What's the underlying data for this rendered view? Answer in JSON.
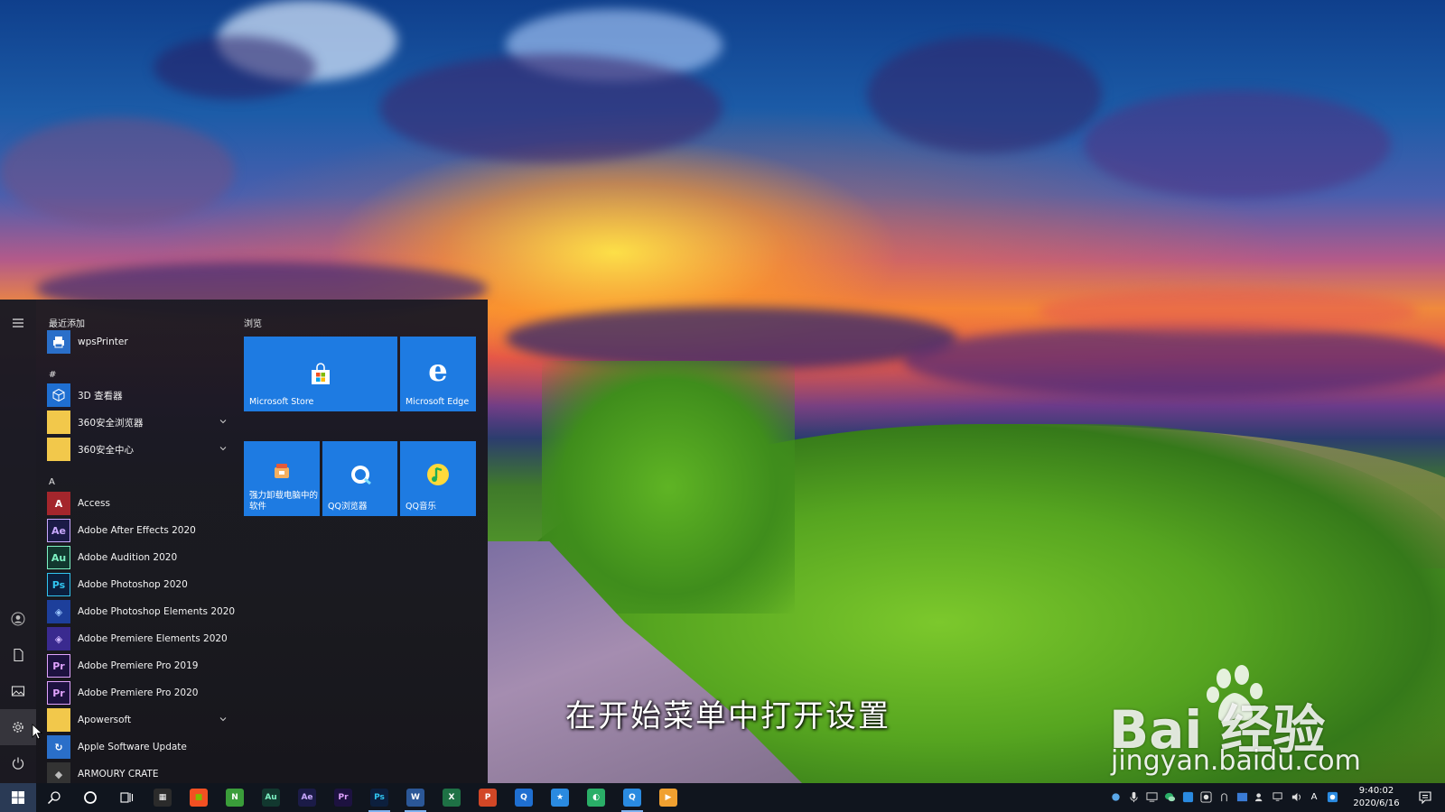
{
  "desktop": {
    "caption": "在开始菜单中打开设置",
    "watermark_logo": "Bai  经验",
    "watermark_url": "jingyan.baidu.com"
  },
  "start_menu": {
    "recent_header": "最近添加",
    "recent_items": [
      {
        "label": "wpsPrinter",
        "icon": "printer-icon",
        "color": "#2a6fc9"
      }
    ],
    "section_hash": "#",
    "hash_items": [
      {
        "label": "3D 查看器",
        "icon": "cube-icon",
        "color": "#1f6fd1"
      },
      {
        "label": "360安全浏览器",
        "icon": "folder-icon",
        "color": "#f2c84b",
        "expandable": true
      },
      {
        "label": "360安全中心",
        "icon": "folder-icon",
        "color": "#f2c84b",
        "expandable": true
      }
    ],
    "section_a": "A",
    "a_items": [
      {
        "label": "Access",
        "icon_text": "A",
        "color": "#a4262c"
      },
      {
        "label": "Adobe After Effects 2020",
        "icon_text": "Ae",
        "color": "#1b1b47"
      },
      {
        "label": "Adobe Audition 2020",
        "icon_text": "Au",
        "color": "#12382f"
      },
      {
        "label": "Adobe Photoshop 2020",
        "icon_text": "Ps",
        "color": "#0c1f3d"
      },
      {
        "label": "Adobe Photoshop Elements 2020",
        "icon_text": "◈",
        "color": "#1d3f9b"
      },
      {
        "label": "Adobe Premiere Elements 2020",
        "icon_text": "◈",
        "color": "#3a2a8f"
      },
      {
        "label": "Adobe Premiere Pro 2019",
        "icon_text": "Pr",
        "color": "#1d1240"
      },
      {
        "label": "Adobe Premiere Pro 2020",
        "icon_text": "Pr",
        "color": "#1d1240"
      },
      {
        "label": "Apowersoft",
        "icon_text": "",
        "color": "#f2c84b",
        "expandable": true
      },
      {
        "label": "Apple Software Update",
        "icon_text": "↻",
        "color": "#2a6fc9"
      },
      {
        "label": "ARMOURY CRATE",
        "icon_text": "◆",
        "color": "#333"
      }
    ],
    "tiles_header": "浏览",
    "tiles": [
      {
        "label": "Microsoft Store",
        "icon": "store-icon"
      },
      {
        "label": "Microsoft Edge",
        "icon": "edge-icon"
      },
      {
        "label": "强力卸载电脑中的软件",
        "icon": "uninstall-icon"
      },
      {
        "label": "QQ浏览器",
        "icon": "qq-browser-icon"
      },
      {
        "label": "QQ音乐",
        "icon": "qq-music-icon"
      }
    ]
  },
  "taskbar": {
    "pinned": [
      {
        "name": "calendar-app",
        "text": "▦",
        "bg": "#2b2b2b",
        "fg": "#fff"
      },
      {
        "name": "microsoft-store-app",
        "text": "■",
        "bg": "#f25022",
        "fg": "#7fba00"
      },
      {
        "name": "green-app",
        "text": "N",
        "bg": "#3a9d3a",
        "fg": "#fff"
      },
      {
        "name": "audition-app",
        "text": "Au",
        "bg": "#12382f",
        "fg": "#7ef2c4"
      },
      {
        "name": "after-effects-app",
        "text": "Ae",
        "bg": "#1b1b47",
        "fg": "#c9a9ff"
      },
      {
        "name": "premiere-app",
        "text": "Pr",
        "bg": "#1d1240",
        "fg": "#e0a3ff"
      },
      {
        "name": "photoshop-app",
        "text": "Ps",
        "bg": "#0c1f3d",
        "fg": "#31c5f0"
      },
      {
        "name": "word-app",
        "text": "W",
        "bg": "#2b5797",
        "fg": "#fff"
      },
      {
        "name": "excel-app",
        "text": "X",
        "bg": "#1e7145",
        "fg": "#fff"
      },
      {
        "name": "powerpoint-app",
        "text": "P",
        "bg": "#d24726",
        "fg": "#fff"
      },
      {
        "name": "qq-browser-app",
        "text": "Q",
        "bg": "#1f6fd1",
        "fg": "#fff"
      },
      {
        "name": "star-app",
        "text": "★",
        "bg": "#2a8ae0",
        "fg": "#fff"
      },
      {
        "name": "wechat-app",
        "text": "◐",
        "bg": "#2aae67",
        "fg": "#fff"
      },
      {
        "name": "qq-app",
        "text": "Q",
        "bg": "#2a8ae0",
        "fg": "#fff"
      },
      {
        "name": "video-app",
        "text": "▶",
        "bg": "#f0a030",
        "fg": "#fff"
      }
    ],
    "clock_time": "9:40:02",
    "clock_date": "2020/6/16",
    "ime": "A"
  }
}
